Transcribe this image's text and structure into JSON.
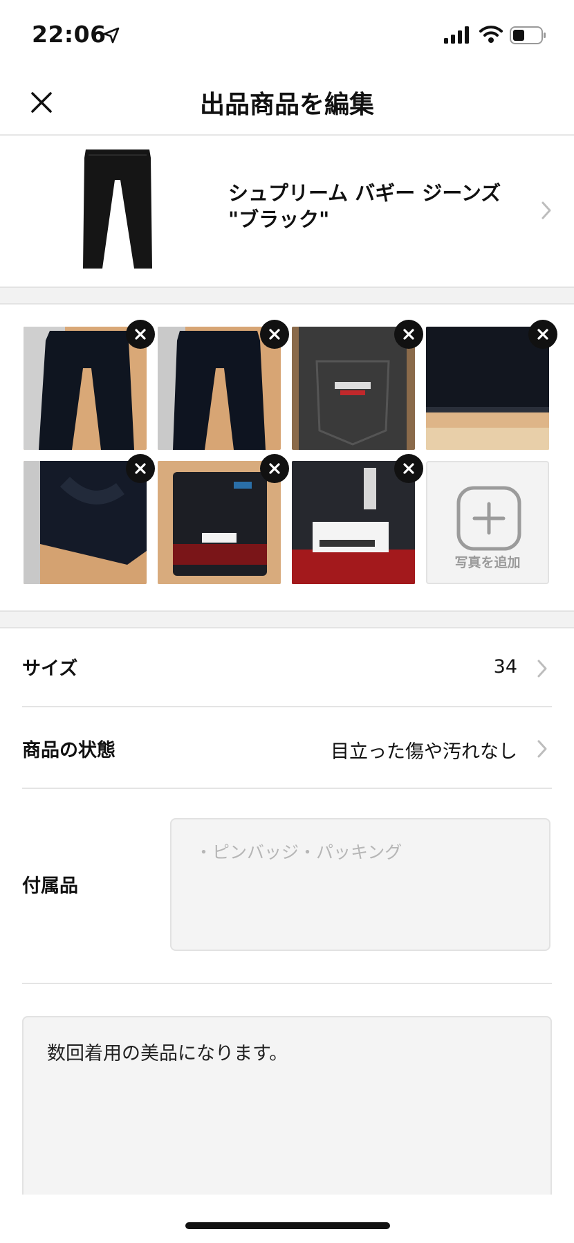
{
  "status_bar": {
    "time": "22:06"
  },
  "header": {
    "title": "出品商品を編集",
    "close_icon": "close-icon"
  },
  "product": {
    "name_line1": "シュプリーム バギー ジーンズ",
    "name_line2": "\"ブラック\""
  },
  "photos": {
    "items": [
      {
        "name": "jeans-front-1",
        "description": "black jeans on floor"
      },
      {
        "name": "jeans-front-2",
        "description": "black jeans on floor"
      },
      {
        "name": "jeans-back-pocket",
        "description": "back pocket with logo"
      },
      {
        "name": "jeans-hem",
        "description": "hem detail"
      },
      {
        "name": "jeans-leg-detail",
        "description": "leg detail"
      },
      {
        "name": "jeans-packaged",
        "description": "in plastic bag"
      },
      {
        "name": "jeans-tag",
        "description": "bag tag close-up"
      }
    ],
    "add_label": "写真を追加"
  },
  "form": {
    "size_label": "サイズ",
    "size_value": "34",
    "condition_label": "商品の状態",
    "condition_value": "目立った傷や汚れなし",
    "accessories_label": "付属品",
    "accessories_placeholder": "・ピンバッジ・パッキング",
    "description_value": "数回着用の美品になります。"
  },
  "colors": {
    "text": "#111111",
    "muted": "#9a9a9a",
    "input_bg": "#f4f4f4",
    "separator": "#e4e4e4"
  }
}
